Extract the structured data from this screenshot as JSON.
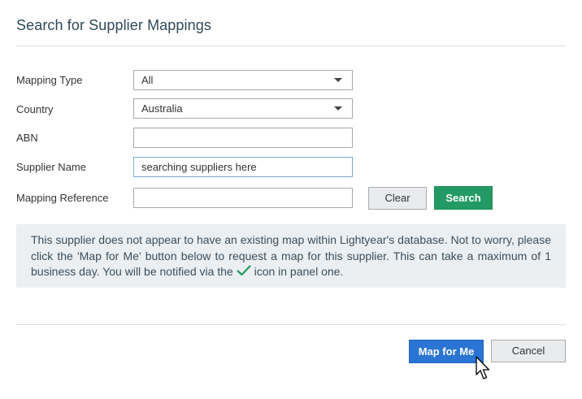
{
  "dialog": {
    "title": "Search for Supplier Mappings"
  },
  "form": {
    "mapping_type": {
      "label": "Mapping Type",
      "value": "All"
    },
    "country": {
      "label": "Country",
      "value": "Australia"
    },
    "abn": {
      "label": "ABN",
      "value": ""
    },
    "supplier_name": {
      "label": "Supplier Name",
      "value": "searching suppliers here"
    },
    "mapping_reference": {
      "label": "Mapping Reference",
      "value": ""
    }
  },
  "buttons": {
    "clear": "Clear",
    "search": "Search",
    "map_for_me": "Map for Me",
    "cancel": "Cancel"
  },
  "notice": {
    "text_before_icon": "This supplier does not appear to have an existing map within Lightyear's database. Not to worry, please click the 'Map for Me' button below to request a map for this supplier. This can take a maximum of 1 business day. You will be notified via the",
    "text_after_icon": "icon in panel one.",
    "icon": "check-icon"
  },
  "colors": {
    "title": "#2f4858",
    "search_button": "#239a63",
    "map_button": "#2a74d3",
    "notice_bg": "#ebeff2",
    "check": "#239a63"
  }
}
